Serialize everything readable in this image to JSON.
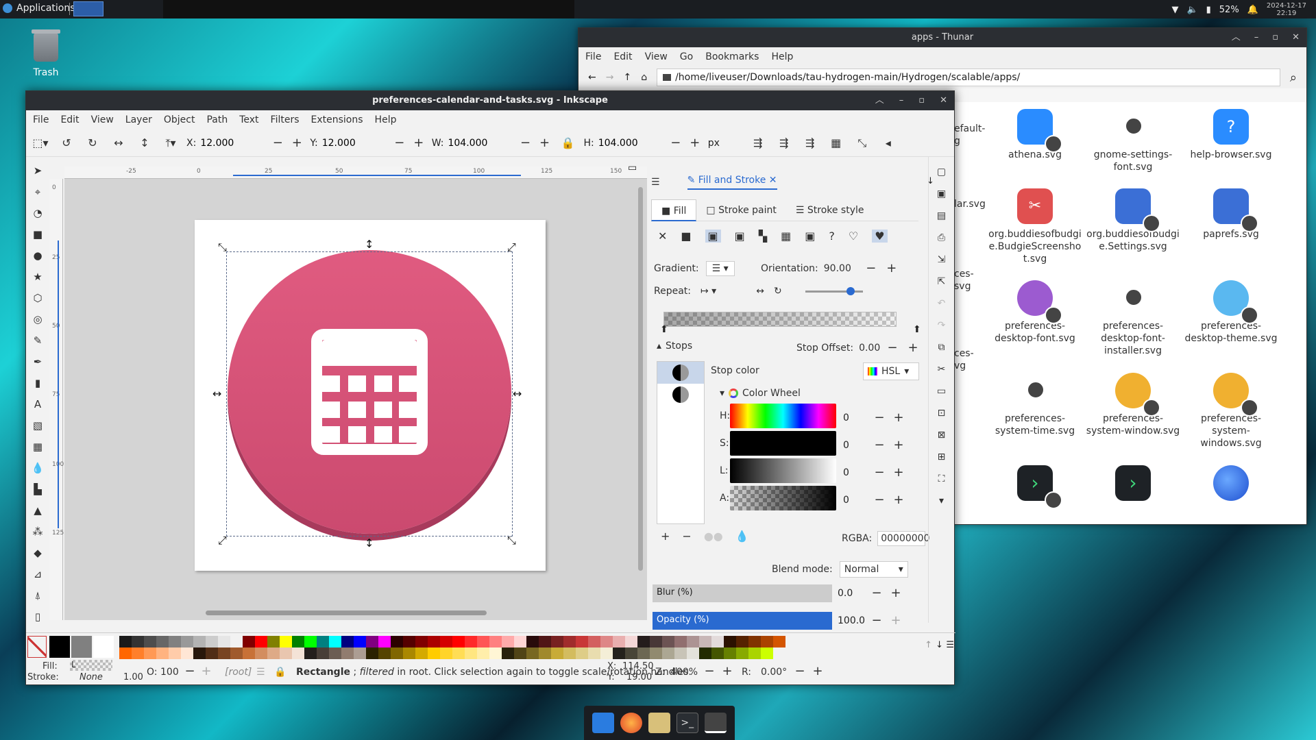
{
  "panel": {
    "apps_label": "Applications",
    "battery": "52%",
    "date": "2024-12-17",
    "time": "22:19"
  },
  "desktop": {
    "trash_label": "Trash"
  },
  "thunar": {
    "title": "apps - Thunar",
    "menu": [
      "File",
      "Edit",
      "View",
      "Go",
      "Bookmarks",
      "Help"
    ],
    "path": "/home/liveuser/Downloads/tau-hydrogen-main/Hydrogen/scalable/apps/",
    "partial_labels": [
      "efault-",
      "g",
      "lar.svg",
      "ces-",
      "svg",
      "ces-",
      "vg"
    ],
    "files": [
      {
        "name": "athena.svg",
        "color": "#2a8cff"
      },
      {
        "name": "gnome-settings-font.svg",
        "color": "#ffffff"
      },
      {
        "name": "help-browser.svg",
        "color": "#2a8cff"
      },
      {
        "name": "org.buddiesofbudgie.BudgieScreenshot.svg",
        "color": "#e05050"
      },
      {
        "name": "org.buddiesofbudgie.Settings.svg",
        "color": "#3b6fd6"
      },
      {
        "name": "paprefs.svg",
        "color": "#3b6fd6"
      },
      {
        "name": "preferences-desktop-font.svg",
        "color": "#9c5bd0"
      },
      {
        "name": "preferences-desktop-font-installer.svg",
        "color": "#ffffff"
      },
      {
        "name": "preferences-desktop-theme.svg",
        "color": "#5ab8f0"
      },
      {
        "name": "preferences-system-time.svg",
        "color": "#ffffff"
      },
      {
        "name": "preferences-system-window.svg",
        "color": "#f0b030"
      },
      {
        "name": "preferences-system-windows.svg",
        "color": "#f0b030"
      }
    ]
  },
  "inkscape": {
    "title": "preferences-calendar-and-tasks.svg - Inkscape",
    "menu": [
      "File",
      "Edit",
      "View",
      "Layer",
      "Object",
      "Path",
      "Text",
      "Filters",
      "Extensions",
      "Help"
    ],
    "toolbar": {
      "x_label": "X:",
      "x": "12.000",
      "y_label": "Y:",
      "y": "12.000",
      "w_label": "W:",
      "w": "104.000",
      "h_label": "H:",
      "h": "104.000",
      "unit": "px"
    },
    "ruler_ticks": [
      "-25",
      "0",
      "25",
      "50",
      "75",
      "100",
      "125",
      "150"
    ],
    "ruler_left_ticks": [
      "0",
      "25",
      "50",
      "75",
      "100",
      "125"
    ],
    "fill_stroke": {
      "tab_title": "Fill and Stroke",
      "tabs": [
        "Fill",
        "Stroke paint",
        "Stroke style"
      ],
      "gradient_label": "Gradient:",
      "orientation_label": "Orientation:",
      "orientation": "90.00",
      "repeat_label": "Repeat:",
      "stops_label": "Stops",
      "stop_offset_label": "Stop Offset:",
      "stop_offset": "0.00",
      "stop_color_label": "Stop color",
      "color_mode": "HSL",
      "color_wheel_label": "Color Wheel",
      "h_label": "H:",
      "h": "0",
      "s_label": "S:",
      "s": "0",
      "l_label": "L:",
      "l": "0",
      "a_label": "A:",
      "a": "0",
      "rgba_label": "RGBA:",
      "rgba": "00000000",
      "blend_label": "Blend mode:",
      "blend": "Normal",
      "blur_label": "Blur (%)",
      "blur": "0.0",
      "opacity_label": "Opacity (%)",
      "opacity": "100.0"
    },
    "status": {
      "fill_label": "Fill:",
      "fill_value": "L",
      "stroke_label": "Stroke:",
      "stroke_value": "None",
      "stroke_width": "1.00",
      "o_label": "O:",
      "o_value": "100",
      "layer": "[root]",
      "message_bold": "Rectangle",
      "message_italic": "filtered",
      "message_rest": " in root. Click selection again to toggle scale/rotation handles.",
      "message_sep": " ; ",
      "cx_label": "X:",
      "cx": "114.50",
      "cy_label": "Y:",
      "cy": "19.00",
      "zoom_label": "Z:",
      "zoom": "400%",
      "rot_label": "R:",
      "rot": "0.00°"
    }
  }
}
